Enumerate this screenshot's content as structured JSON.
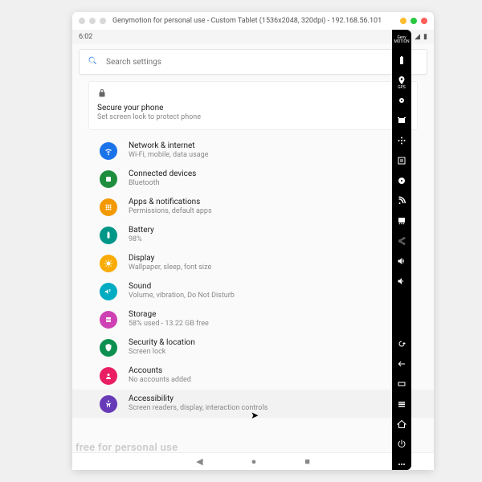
{
  "titlebar": {
    "title": "Genymotion for personal use - Custom Tablet (1536x2048, 320dpi) - 192.168.56.101"
  },
  "statusbar": {
    "time": "6:02"
  },
  "search": {
    "placeholder": "Search settings"
  },
  "suggestion": {
    "title": "Secure your phone",
    "subtitle": "Set screen lock to protect phone"
  },
  "items": [
    {
      "title": "Network & internet",
      "subtitle": "Wi-Fi, mobile, data usage",
      "color": "c-blue",
      "icon": "wifi",
      "name": "network-internet"
    },
    {
      "title": "Connected devices",
      "subtitle": "Bluetooth",
      "color": "c-green",
      "icon": "devices",
      "name": "connected-devices"
    },
    {
      "title": "Apps & notifications",
      "subtitle": "Permissions, default apps",
      "color": "c-orange",
      "icon": "apps",
      "name": "apps-notifications"
    },
    {
      "title": "Battery",
      "subtitle": "98%",
      "color": "c-teal",
      "icon": "battery",
      "name": "battery"
    },
    {
      "title": "Display",
      "subtitle": "Wallpaper, sleep, font size",
      "color": "c-amber",
      "icon": "display",
      "name": "display"
    },
    {
      "title": "Sound",
      "subtitle": "Volume, vibration, Do Not Disturb",
      "color": "c-cyan",
      "icon": "sound",
      "name": "sound"
    },
    {
      "title": "Storage",
      "subtitle": "58% used - 13.22 GB free",
      "color": "c-magenta",
      "icon": "storage",
      "name": "storage"
    },
    {
      "title": "Security & location",
      "subtitle": "Screen lock",
      "color": "c-green2",
      "icon": "security",
      "name": "security-location"
    },
    {
      "title": "Accounts",
      "subtitle": "No accounts added",
      "color": "c-pink",
      "icon": "accounts",
      "name": "accounts"
    },
    {
      "title": "Accessibility",
      "subtitle": "Screen readers, display, interaction controls",
      "color": "c-purple",
      "icon": "accessibility",
      "name": "accessibility",
      "highlight": true
    }
  ],
  "watermark": "free for personal use",
  "sidebar": {
    "gps_label": "GPS"
  }
}
